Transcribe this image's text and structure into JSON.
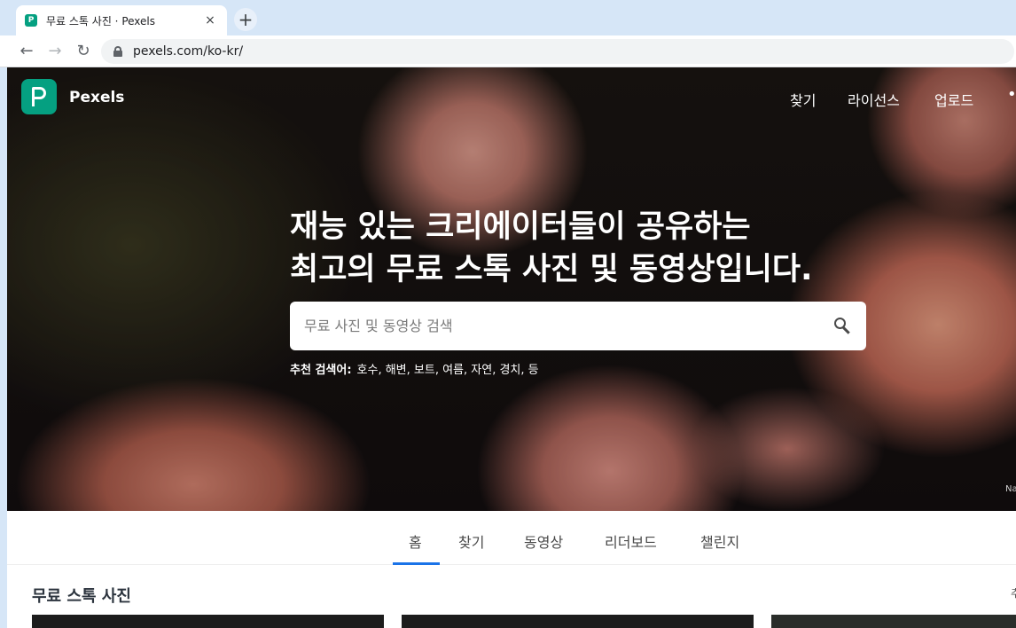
{
  "browser": {
    "tab_title": "무료 스톡 사진 · Pexels",
    "tab_favicon": "P",
    "close_glyph": "×",
    "new_tab_glyph": "+",
    "url": "pexels.com/ko-kr/",
    "back_glyph": "←",
    "forward_glyph": "→",
    "reload_glyph": "↻",
    "icons": [
      "lock-icon",
      "reload-icon",
      "back-arrow-icon",
      "forward-arrow-icon"
    ]
  },
  "header": {
    "brand": "Pexels",
    "nav": {
      "find": "찾기",
      "license": "라이선스",
      "upload": "업로드",
      "more": "••"
    }
  },
  "hero": {
    "headline_line1": "재능 있는 크리에이터들이 공유하는",
    "headline_line2": "최고의 무료 스톡 사진 및 동영상입니다.",
    "search_placeholder": "무료 사진 및 동영상 검색",
    "suggestions_label": "추천 검색어:",
    "suggestions": "호수, 해변, 보트, 여름, 자연, 경치, 등",
    "credit": "Na"
  },
  "tabs": {
    "home": "홈",
    "find": "찾기",
    "video": "동영상",
    "leaderboard": "리더보드",
    "challenge": "챌린지"
  },
  "section": {
    "title": "무료 스톡 사진",
    "right_char": "추"
  },
  "colors": {
    "brand": "#05a081",
    "tab_active_underline": "#1a73e8"
  }
}
